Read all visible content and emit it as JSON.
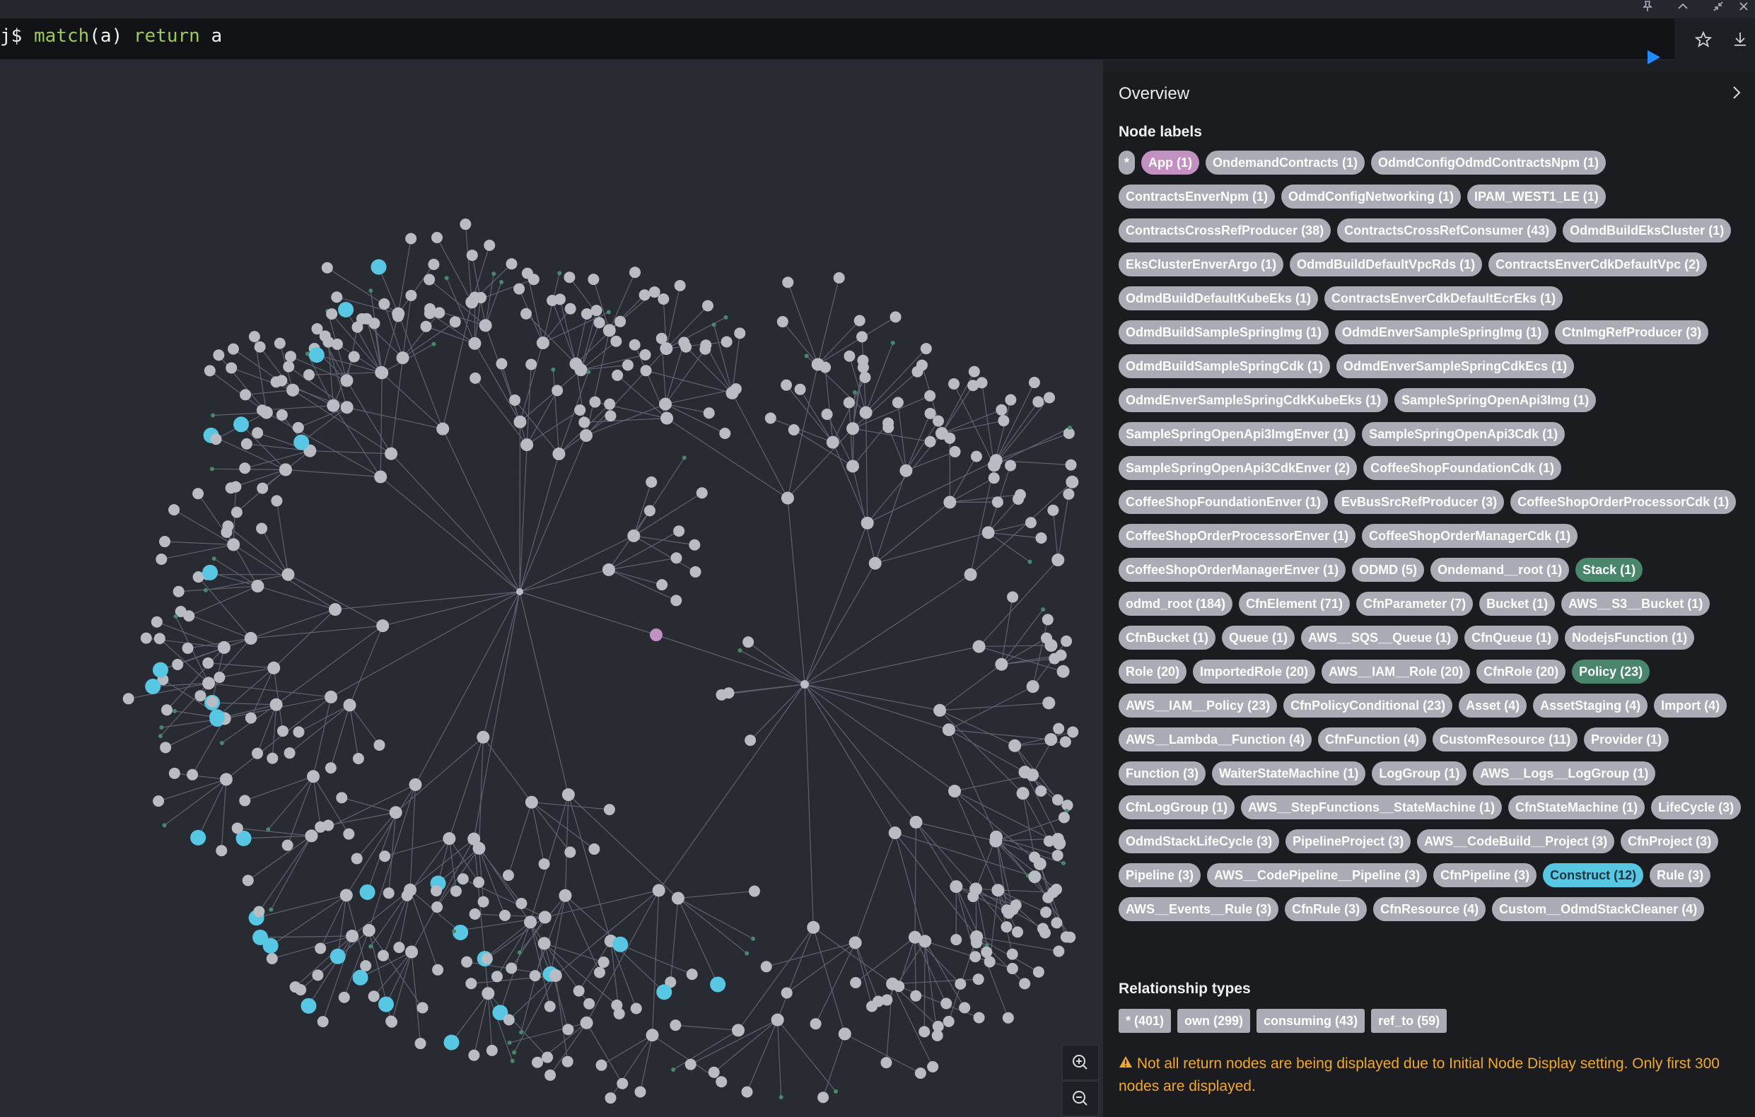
{
  "query": {
    "prompt": "j$",
    "parts": [
      {
        "text": "match",
        "kw": true
      },
      {
        "text": "(a) ",
        "kw": false
      },
      {
        "text": "return",
        "kw": true
      },
      {
        "text": " a",
        "kw": false
      }
    ]
  },
  "panel": {
    "title": "Overview",
    "node_labels_heading": "Node labels",
    "relationship_heading": "Relationship types",
    "node_labels": [
      {
        "text": "*",
        "style": "star"
      },
      {
        "text": "App (1)",
        "style": "app"
      },
      {
        "text": "OndemandContracts (1)"
      },
      {
        "text": "OdmdConfigOdmdContractsNpm (1)"
      },
      {
        "text": "ContractsEnverNpm (1)"
      },
      {
        "text": "OdmdConfigNetworking (1)"
      },
      {
        "text": "IPAM_WEST1_LE (1)"
      },
      {
        "text": "ContractsCrossRefProducer (38)"
      },
      {
        "text": "ContractsCrossRefConsumer (43)"
      },
      {
        "text": "OdmdBuildEksCluster (1)"
      },
      {
        "text": "EksClusterEnverArgo (1)"
      },
      {
        "text": "OdmdBuildDefaultVpcRds (1)"
      },
      {
        "text": "ContractsEnverCdkDefaultVpc (2)"
      },
      {
        "text": "OdmdBuildDefaultKubeEks (1)"
      },
      {
        "text": "ContractsEnverCdkDefaultEcrEks (1)"
      },
      {
        "text": "OdmdBuildSampleSpringImg (1)"
      },
      {
        "text": "OdmdEnverSampleSpringImg (1)"
      },
      {
        "text": "CtnImgRefProducer (3)"
      },
      {
        "text": "OdmdBuildSampleSpringCdk (1)"
      },
      {
        "text": "OdmdEnverSampleSpringCdkEcs (1)"
      },
      {
        "text": "OdmdEnverSampleSpringCdkKubeEks (1)"
      },
      {
        "text": "SampleSpringOpenApi3Img (1)"
      },
      {
        "text": "SampleSpringOpenApi3ImgEnver (1)"
      },
      {
        "text": "SampleSpringOpenApi3Cdk (1)"
      },
      {
        "text": "SampleSpringOpenApi3CdkEnver (2)"
      },
      {
        "text": "CoffeeShopFoundationCdk (1)"
      },
      {
        "text": "CoffeeShopFoundationEnver (1)"
      },
      {
        "text": "EvBusSrcRefProducer (3)"
      },
      {
        "text": "CoffeeShopOrderProcessorCdk (1)"
      },
      {
        "text": "CoffeeShopOrderProcessorEnver (1)"
      },
      {
        "text": "CoffeeShopOrderManagerCdk (1)"
      },
      {
        "text": "CoffeeShopOrderManagerEnver (1)"
      },
      {
        "text": "ODMD (5)"
      },
      {
        "text": "Ondemand__root (1)"
      },
      {
        "text": "Stack (1)",
        "style": "green"
      },
      {
        "text": "odmd_root (184)"
      },
      {
        "text": "CfnElement (71)"
      },
      {
        "text": "CfnParameter (7)"
      },
      {
        "text": "Bucket (1)"
      },
      {
        "text": "AWS__S3__Bucket (1)"
      },
      {
        "text": "CfnBucket (1)"
      },
      {
        "text": "Queue (1)"
      },
      {
        "text": "AWS__SQS__Queue (1)"
      },
      {
        "text": "CfnQueue (1)"
      },
      {
        "text": "NodejsFunction (1)"
      },
      {
        "text": "Role (20)"
      },
      {
        "text": "ImportedRole (20)"
      },
      {
        "text": "AWS__IAM__Role (20)"
      },
      {
        "text": "CfnRole (20)"
      },
      {
        "text": "Policy (23)",
        "style": "green"
      },
      {
        "text": "AWS__IAM__Policy (23)"
      },
      {
        "text": "CfnPolicyConditional (23)"
      },
      {
        "text": "Asset (4)"
      },
      {
        "text": "AssetStaging (4)"
      },
      {
        "text": "Import (4)"
      },
      {
        "text": "AWS__Lambda__Function (4)"
      },
      {
        "text": "CfnFunction (4)"
      },
      {
        "text": "CustomResource (11)"
      },
      {
        "text": "Provider (1)"
      },
      {
        "text": "Function (3)"
      },
      {
        "text": "WaiterStateMachine (1)"
      },
      {
        "text": "LogGroup (1)"
      },
      {
        "text": "AWS__Logs__LogGroup (1)"
      },
      {
        "text": "CfnLogGroup (1)"
      },
      {
        "text": "AWS__StepFunctions__StateMachine (1)"
      },
      {
        "text": "CfnStateMachine (1)"
      },
      {
        "text": "LifeCycle (3)"
      },
      {
        "text": "OdmdStackLifeCycle (3)"
      },
      {
        "text": "PipelineProject (3)"
      },
      {
        "text": "AWS__CodeBuild__Project (3)"
      },
      {
        "text": "CfnProject (3)"
      },
      {
        "text": "Pipeline (3)"
      },
      {
        "text": "AWS__CodePipeline__Pipeline (3)"
      },
      {
        "text": "CfnPipeline (3)"
      },
      {
        "text": "Construct (12)",
        "style": "cyan"
      },
      {
        "text": "Rule (3)"
      },
      {
        "text": "AWS__Events__Rule (3)"
      },
      {
        "text": "CfnRule (3)"
      },
      {
        "text": "CfnResource (4)"
      },
      {
        "text": "Custom__OdmdStackCleaner (4)"
      }
    ],
    "relationship_types": [
      "* (401)",
      "own (299)",
      "consuming (43)",
      "ref_to (59)"
    ],
    "warning": "Not all return nodes are being displayed due to Initial Node Display setting. Only first 300 nodes are displayed."
  },
  "colors": {
    "node_default": "#b9bcc3",
    "node_construct": "#57c7e3",
    "node_app": "#c291c2",
    "node_policy": "#4a866b",
    "edge": "#5f6370",
    "warning": "#f0a830",
    "run_button": "#1f8bff"
  },
  "icons": {
    "run": "play-icon",
    "favorite": "star-icon",
    "download": "download-icon",
    "zoom_in": "zoom-in-icon",
    "zoom_out": "zoom-out-icon",
    "collapse": "chevron-right-icon",
    "warning": "warning-icon",
    "window": [
      "pin-icon",
      "chevron-up-icon",
      "shrink-icon",
      "close-icon"
    ]
  }
}
